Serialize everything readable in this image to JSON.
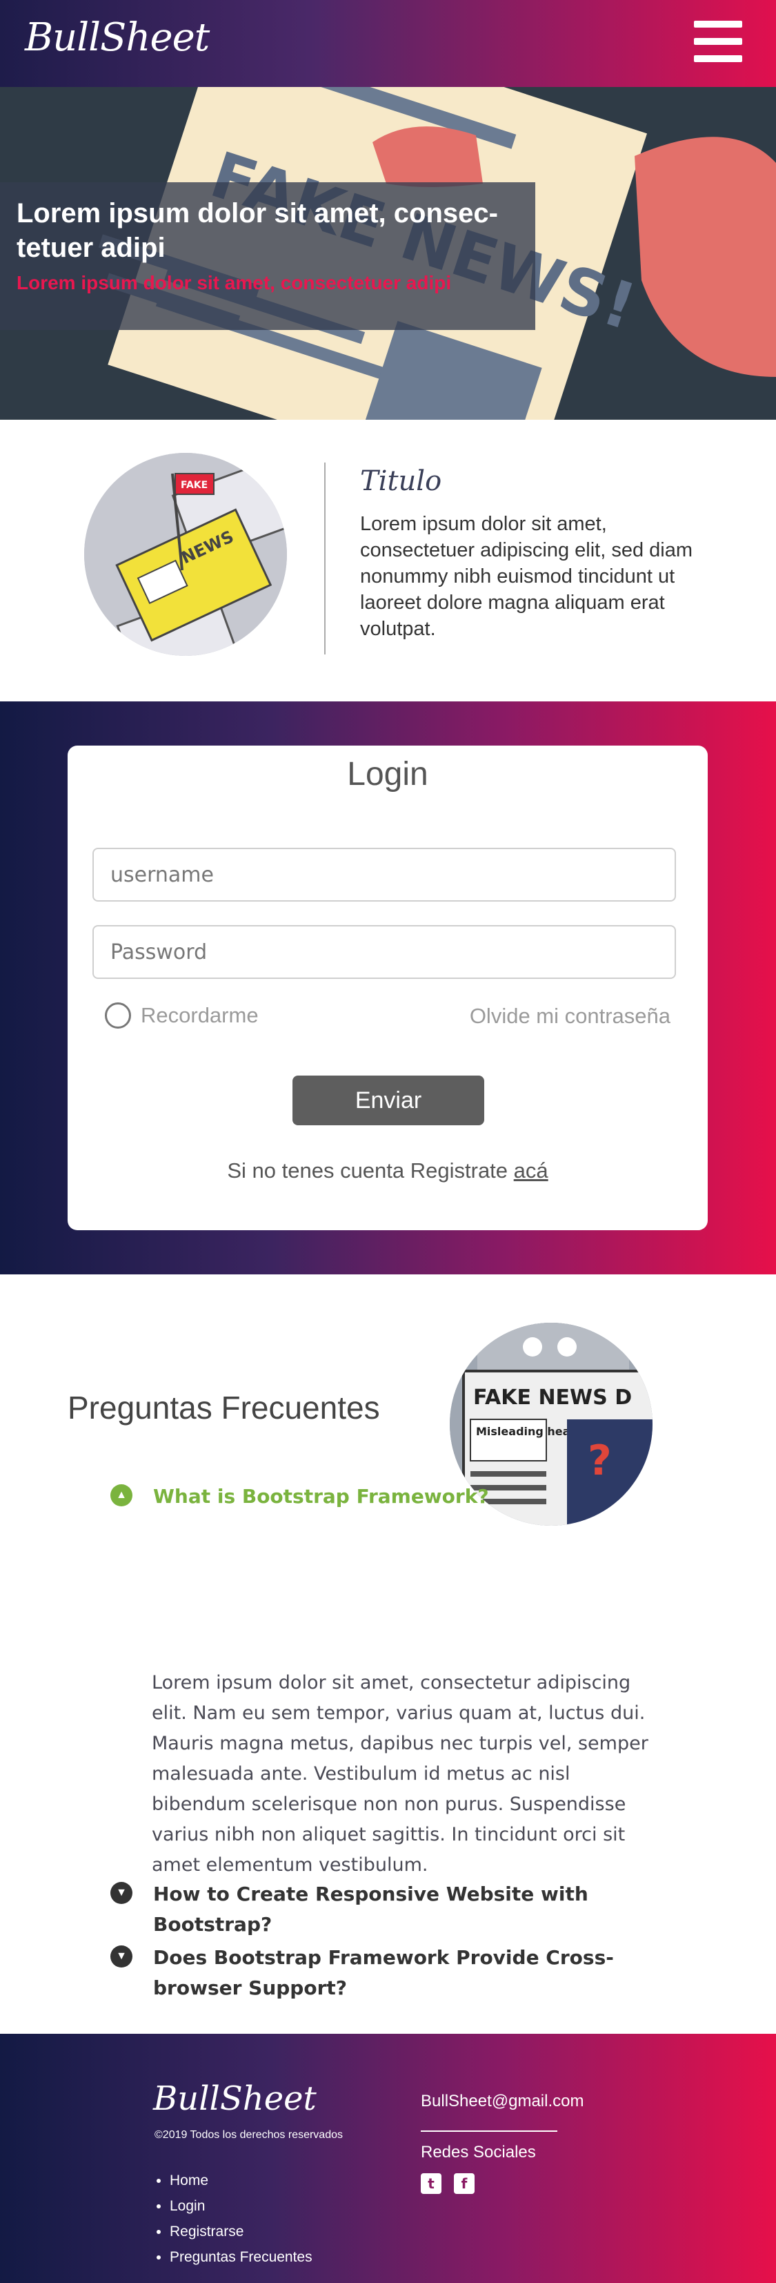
{
  "nav": {
    "brand": "BullSheet",
    "menu_icon": "hamburger-icon"
  },
  "hero": {
    "title": "Lorem ipsum dolor sit amet, consec-tetuer adipi",
    "subtitle": "Lorem ipsum dolor sit amet, consectetuer adipi",
    "image_text": "FAKE NEWS!"
  },
  "intro": {
    "flag_text": "FAKE",
    "paper_text": "NEWS",
    "title": "Titulo",
    "text": "Lorem ipsum dolor sit amet, consectetuer adipiscing elit, sed diam nonummy nibh euismod tincidunt ut laoreet dolore magna aliquam erat volutpat."
  },
  "login": {
    "title": "Login",
    "username_placeholder": "username",
    "password_placeholder": "Password",
    "remember_label": "Recordarme",
    "forgot_label": "Olvide mi contraseña",
    "submit_label": "Enviar",
    "register_text": "Si no tenes cuenta Registrate",
    "register_link": "acá"
  },
  "faq": {
    "title": "Preguntas Frecuentes",
    "image_headline": "FAKE NEWS D",
    "image_sub": "Misleading headline",
    "questions": [
      {
        "text": "What is Bootstrap Framework?",
        "expanded": true
      },
      {
        "text": "How to Create Responsive Website with Bootstrap?",
        "expanded": false
      },
      {
        "text": "Does Bootstrap Framework Provide Cross-browser Support?",
        "expanded": false
      }
    ],
    "answer": "Lorem ipsum dolor sit amet, consectetur adipiscing elit. Nam eu sem tempor, varius quam at, luctus dui. Mauris magna metus, dapibus nec turpis vel, semper malesuada ante. Vestibulum id metus ac nisl bibendum scelerisque non non purus. Suspendisse varius nibh non aliquet sagittis. In tincidunt orci sit amet elementum vestibulum."
  },
  "footer": {
    "brand": "BullSheet",
    "copyright": "©2019 Todos los derechos reservados",
    "links": [
      "Home",
      "Login",
      "Registrarse",
      "Preguntas Frecuentes"
    ],
    "email": "BullSheet@gmail.com",
    "social_title": "Redes Sociales",
    "social_icons": [
      "twitter-icon",
      "facebook-icon"
    ]
  },
  "colors": {
    "accent": "#e8174f",
    "faq_active": "#7ab33e",
    "faq_inactive": "#333333",
    "button": "#5e5e5e"
  }
}
